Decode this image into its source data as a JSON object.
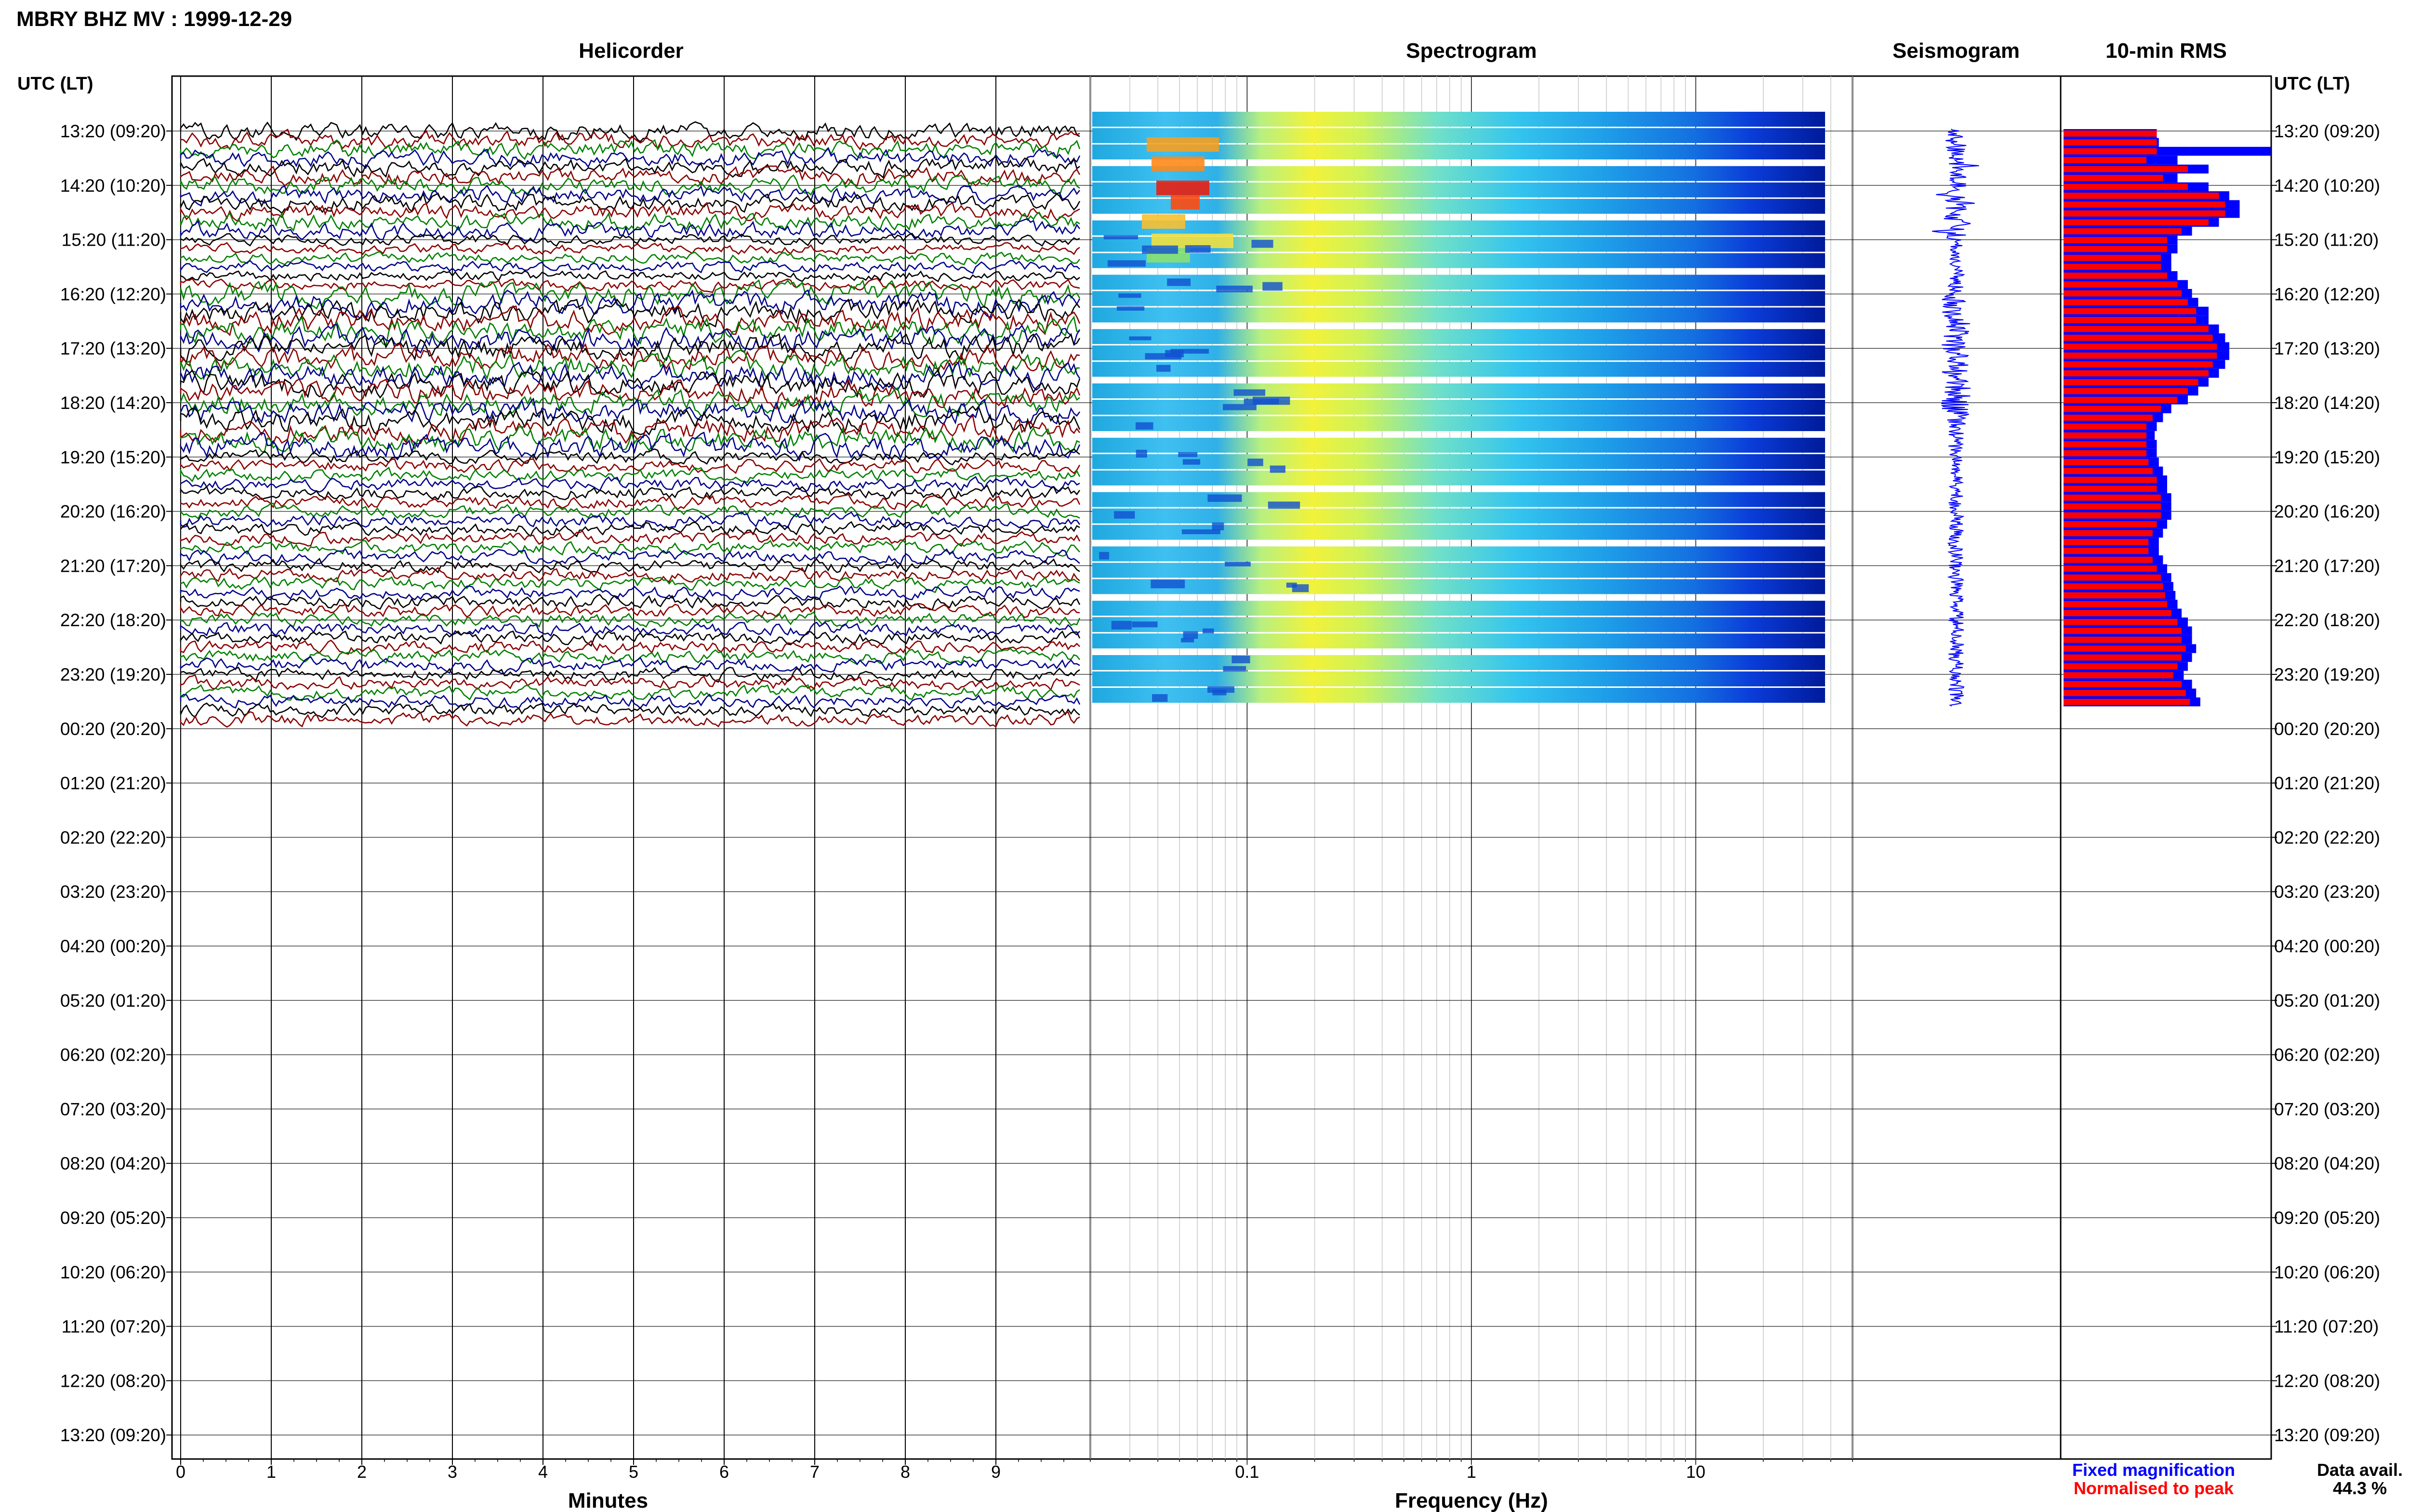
{
  "station_title": "MBRY BHZ MV : 1999-12-29",
  "time_axis_label": "UTC (LT)",
  "panels": {
    "helicorder": "Helicorder",
    "spectrogram": "Spectrogram",
    "seismogram": "Seismogram",
    "rms": "10-min RMS"
  },
  "time_rows": [
    "13:20 (09:20)",
    "14:20 (10:20)",
    "15:20 (11:20)",
    "16:20 (12:20)",
    "17:20 (13:20)",
    "18:20 (14:20)",
    "19:20 (15:20)",
    "20:20 (16:20)",
    "21:20 (17:20)",
    "22:20 (18:20)",
    "23:20 (19:20)",
    "00:20 (20:20)",
    "01:20 (21:20)",
    "02:20 (22:20)",
    "03:20 (23:20)",
    "04:20 (00:20)",
    "05:20 (01:20)",
    "06:20 (02:20)",
    "07:20 (03:20)",
    "08:20 (04:20)",
    "09:20 (05:20)",
    "10:20 (06:20)",
    "11:20 (07:20)",
    "12:20 (08:20)",
    "13:20 (09:20)"
  ],
  "footer": {
    "minutes_label": "Minutes",
    "frequency_label": "Frequency (Hz)",
    "legend_fixed": "Fixed magnification",
    "legend_normalised": "Normalised to peak",
    "data_avail_label": "Data avail.",
    "data_avail_value": "44.3 %"
  },
  "colors": {
    "fixed": "#0000ff",
    "normalised": "#ff0000",
    "trace_cycle": [
      "#000000",
      "#8b0000",
      "#008000",
      "#00008b"
    ]
  },
  "chart_data": [
    {
      "type": "line",
      "name": "helicorder",
      "title": "Helicorder",
      "xlabel": "Minutes",
      "x_ticks": [
        "0",
        "1",
        "2",
        "3",
        "4",
        "5",
        "6",
        "7",
        "8",
        "9"
      ],
      "xlim": [
        0,
        10
      ],
      "rows_with_data": 11,
      "rows_total": 24,
      "traces_per_row": 6
    },
    {
      "type": "heatmap",
      "name": "spectrogram",
      "title": "Spectrogram",
      "xlabel": "Frequency (Hz)",
      "x_scale": "log",
      "xlim": [
        0.02,
        50
      ],
      "x_ticks": [
        "0.1",
        "1",
        "10"
      ],
      "colormap": "jet",
      "rows_with_data": 11
    },
    {
      "type": "line",
      "name": "seismogram",
      "title": "Seismogram",
      "rows_with_data": 11
    },
    {
      "type": "bar",
      "name": "10-min RMS",
      "title": "10-min RMS",
      "orientation": "horizontal",
      "series": [
        {
          "name": "Fixed magnification",
          "values": [
            0.45,
            0.46,
            1.0,
            0.55,
            0.7,
            0.55,
            0.7,
            0.8,
            0.85,
            0.85,
            0.75,
            0.62,
            0.55,
            0.55,
            0.52,
            0.52,
            0.55,
            0.6,
            0.62,
            0.65,
            0.7,
            0.7,
            0.75,
            0.78,
            0.8,
            0.8,
            0.78,
            0.75,
            0.7,
            0.65,
            0.6,
            0.52,
            0.48,
            0.45,
            0.44,
            0.45,
            0.45,
            0.46,
            0.48,
            0.5,
            0.5,
            0.52,
            0.52,
            0.52,
            0.5,
            0.48,
            0.46,
            0.46,
            0.48,
            0.5,
            0.52,
            0.53,
            0.54,
            0.55,
            0.57,
            0.6,
            0.62,
            0.62,
            0.64,
            0.62,
            0.6,
            0.58,
            0.62,
            0.64,
            0.66
          ]
        },
        {
          "name": "Normalised to peak",
          "values": [
            0.45,
            0.45,
            0.45,
            0.4,
            0.6,
            0.48,
            0.6,
            0.75,
            0.78,
            0.78,
            0.7,
            0.57,
            0.5,
            0.5,
            0.47,
            0.47,
            0.5,
            0.55,
            0.57,
            0.6,
            0.64,
            0.64,
            0.7,
            0.72,
            0.74,
            0.74,
            0.72,
            0.7,
            0.65,
            0.6,
            0.55,
            0.47,
            0.43,
            0.4,
            0.4,
            0.4,
            0.4,
            0.41,
            0.43,
            0.45,
            0.45,
            0.47,
            0.47,
            0.47,
            0.45,
            0.43,
            0.41,
            0.41,
            0.43,
            0.45,
            0.47,
            0.48,
            0.49,
            0.5,
            0.52,
            0.55,
            0.57,
            0.57,
            0.59,
            0.57,
            0.55,
            0.53,
            0.57,
            0.59,
            0.61
          ]
        }
      ]
    }
  ]
}
